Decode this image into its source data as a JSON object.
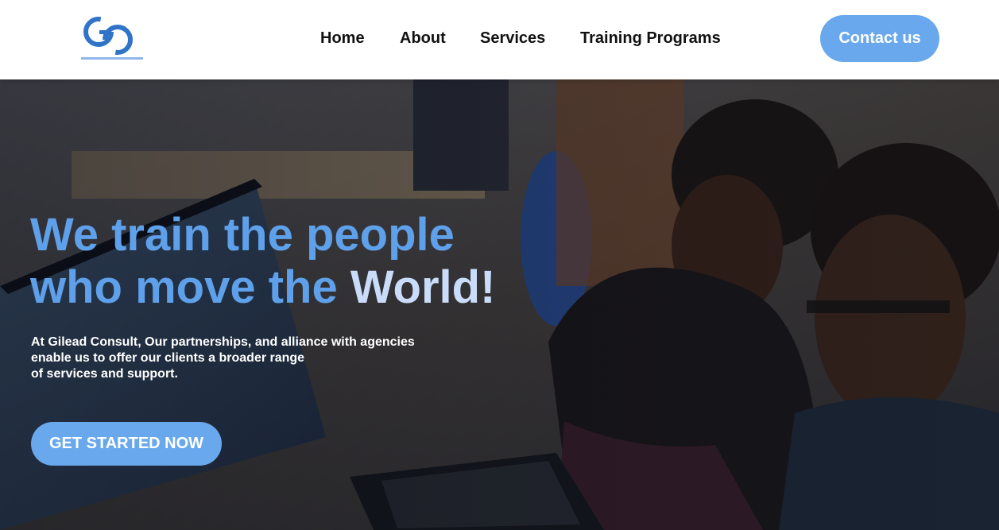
{
  "brand": {
    "logo_letters": "GC",
    "tagline": "we train the people who move the world"
  },
  "nav": {
    "items": [
      {
        "label": "Home"
      },
      {
        "label": "About"
      },
      {
        "label": "Services"
      },
      {
        "label": "Training Programs"
      }
    ],
    "contact_label": "Contact us"
  },
  "hero": {
    "headline_line1": "We train the people",
    "headline_line2_prefix": "who move the",
    "headline_line2_emphasis": "World!",
    "subtext_lines": [
      "At Gilead Consult, Our partnerships, and alliance with agencies",
      "enable us to offer our clients a broader range",
      "of services and support."
    ],
    "cta_label": "GET STARTED NOW"
  },
  "colors": {
    "accent": "#69a8ec",
    "headline": "#5ea0ea",
    "emphasis": "#c9ddfb",
    "header_bg": "#ffffff"
  }
}
